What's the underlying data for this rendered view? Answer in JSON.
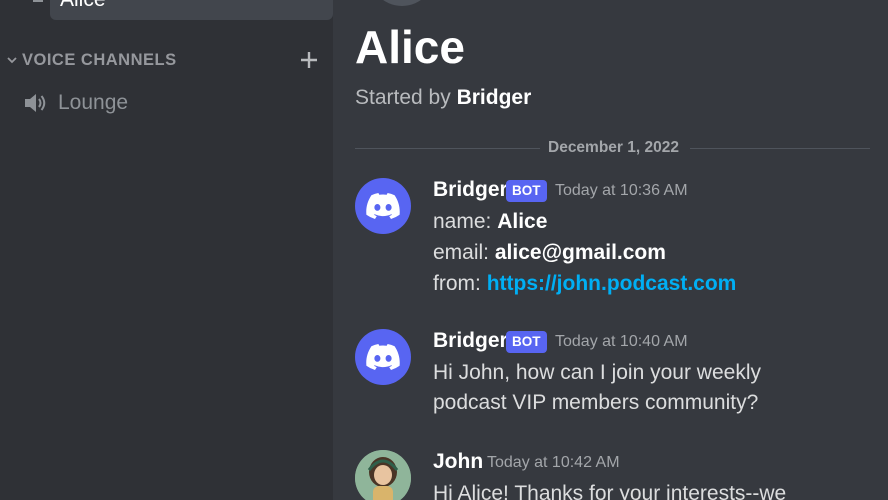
{
  "sidebar": {
    "selected_channel": "Alice",
    "voice_category": "VOICE CHANNELS",
    "voice_channels": [
      {
        "label": "Lounge"
      }
    ]
  },
  "thread": {
    "title": "Alice",
    "started_by_prefix": "Started by",
    "started_by_name": "Bridger"
  },
  "date_divider": "December 1, 2022",
  "messages": [
    {
      "author": "Bridger",
      "bot_tag": "BOT",
      "timestamp": "Today at 10:36 AM",
      "name_label": "name:",
      "name_value": "Alice",
      "email_label": "email:",
      "email_value": "alice@gmail.com",
      "from_label": "from:",
      "from_value": "https://john.podcast.com"
    },
    {
      "author": "Bridger",
      "bot_tag": "BOT",
      "timestamp": "Today at 10:40 AM",
      "lines": [
        "Hi John, how can I join your weekly",
        "podcast VIP members community?"
      ]
    },
    {
      "author": "John",
      "timestamp": "Today at 10:42 AM",
      "lines": [
        "Hi Alice! Thanks for your interests--we"
      ]
    }
  ],
  "colors": {
    "background": "#36393f",
    "sidebar": "#2f3136",
    "blurple": "#5865f2",
    "link": "#00aff4"
  }
}
